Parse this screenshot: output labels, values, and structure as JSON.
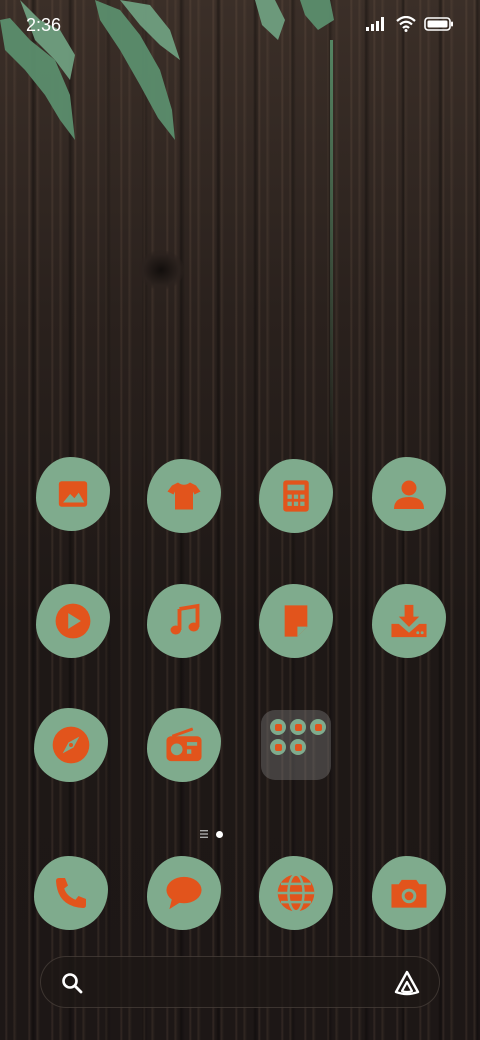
{
  "status_bar": {
    "time": "2:36",
    "icons": [
      "signal-icon",
      "wifi-icon",
      "battery-icon"
    ]
  },
  "home_grid": {
    "rows": [
      [
        {
          "id": "gallery",
          "icon": "image-icon"
        },
        {
          "id": "themes",
          "icon": "tshirt-icon"
        },
        {
          "id": "calculator",
          "icon": "calculator-icon"
        },
        {
          "id": "contacts",
          "icon": "person-icon"
        }
      ],
      [
        {
          "id": "video",
          "icon": "play-icon"
        },
        {
          "id": "music",
          "icon": "music-note-icon"
        },
        {
          "id": "notes",
          "icon": "note-icon"
        },
        {
          "id": "downloads",
          "icon": "download-icon"
        }
      ],
      [
        {
          "id": "compass",
          "icon": "compass-icon"
        },
        {
          "id": "radio",
          "icon": "radio-icon"
        },
        {
          "id": "folder",
          "icon": "folder-icon"
        }
      ]
    ]
  },
  "page_indicator": {
    "pages": 1,
    "current": 0
  },
  "dock": [
    {
      "id": "phone",
      "icon": "phone-icon"
    },
    {
      "id": "messages",
      "icon": "chat-bubble-icon"
    },
    {
      "id": "browser",
      "icon": "globe-icon"
    },
    {
      "id": "camera",
      "icon": "camera-icon"
    }
  ],
  "search_bar": {
    "left_icon": "search-icon",
    "right_icon": "assistant-icon"
  },
  "colors": {
    "icon_bg": "#7fab8d",
    "glyph": "#e2541c",
    "leaf": "#5b8e6d"
  }
}
